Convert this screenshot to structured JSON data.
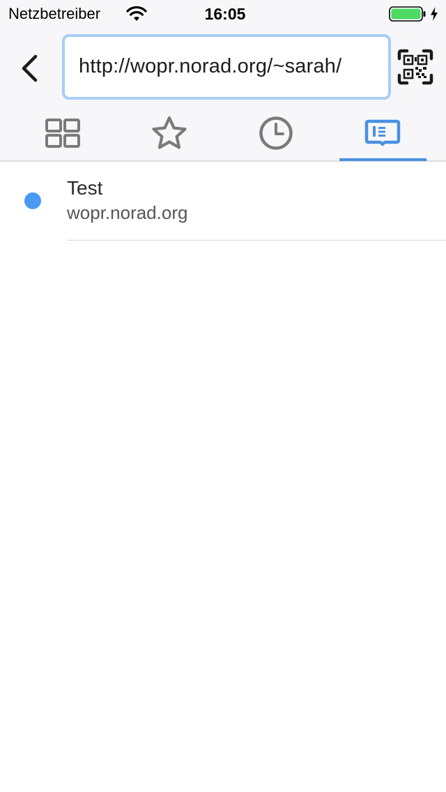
{
  "status_bar": {
    "carrier": "Netzbetreiber",
    "time": "16:05",
    "battery_level": 1.0,
    "battery_color": "#4cd964",
    "charging": true
  },
  "toolbar": {
    "back_icon": "chevron-left-icon",
    "url": "http://wopr.norad.org/~sarah/",
    "url_border_color": "#a9cdf7",
    "qr_icon": "qr-code-scan-icon"
  },
  "tabs": {
    "items": [
      {
        "icon": "grid-icon",
        "selected": false
      },
      {
        "icon": "star-icon",
        "selected": false
      },
      {
        "icon": "clock-icon",
        "selected": false
      },
      {
        "icon": "reading-list-icon",
        "selected": true
      }
    ],
    "accent_color": "#4a90e2",
    "inactive_color": "#7a7a7a"
  },
  "reading_list": {
    "items": [
      {
        "title": "Test",
        "url": "wopr.norad.org",
        "unread": true
      }
    ],
    "unread_dot_color": "#4a9af5"
  }
}
